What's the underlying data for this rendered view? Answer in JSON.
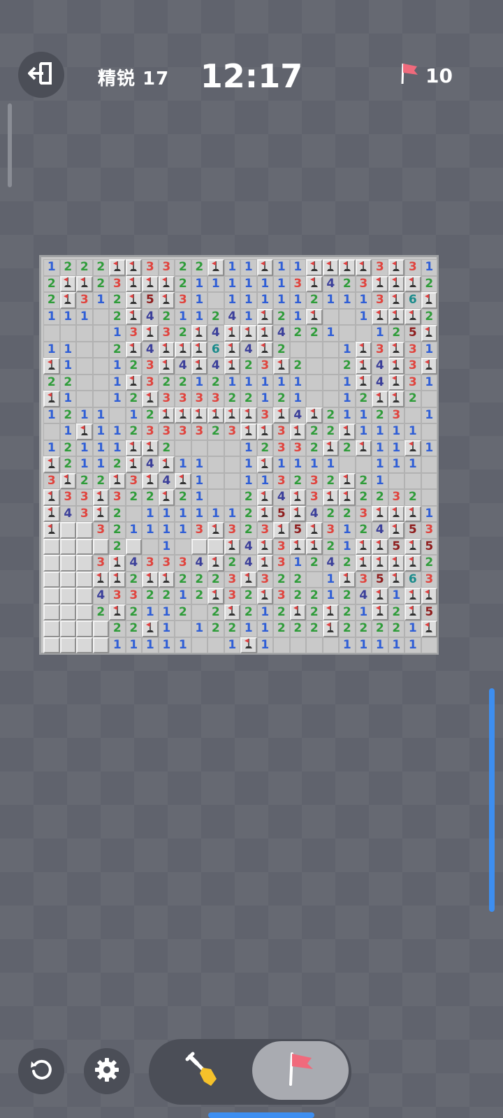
{
  "header": {
    "level_label": "精锐 17",
    "timer": "12:17",
    "flags_remaining": "10"
  },
  "icons": {
    "exit": "exit-icon",
    "flag": "flag-icon",
    "undo": "undo-icon",
    "settings": "gear-icon",
    "dig": "shovel-icon",
    "flag_tool": "flag-icon"
  },
  "colors": {
    "background": "#60636d",
    "flag": "#f06a7c",
    "accent": "#3d8ef0"
  },
  "board": {
    "columns": 24,
    "legend": "F = flagged cell, # = unrevealed cell, . = revealed empty, digit = revealed number",
    "rows": [
      "1222FF3322F11F11FFFF3F31",
      "2FF23FFF21111113F423FFF2",
      "2F312F5F31.1111121113F6F3",
      "111.2F4211241F21F..1FFF2",
      "....13F32F4FFF4221..125F41",
      "11..2F4FFF6F4F2...1F3F31",
      "F1..123F4F4F23F2..2F4F3F",
      "22..1F3221211111..1F4F31",
      "F1..12F333322121..12FF2.",
      "1211.12FFFFFF3F4F21123.1.",
      ".1F112333323FF3F22F1111",
      "12111FF2....12332F2F11F1",
      "F2112F4F11..1F1111..111",
      "3F22F3F4F1..113232F21...",
      "F33F322F21..2F4F3FF2232.1",
      "F43F2.1111112F5F4223FFF1",
      "F##3211113F323F5F3124F532",
      "####2#.1.##F4F3FF21FF5F5F2",
      "###3F43334F24F31242FFFF2",
      "###FF2FF2223F322.1F35F63",
      "###4332212F32F322124F1FF",
      "###2F2112.2F212F2F21F2F53",
      "####22F1.12211222F22221F",
      "####11111..1F1....11111.11"
    ]
  }
}
